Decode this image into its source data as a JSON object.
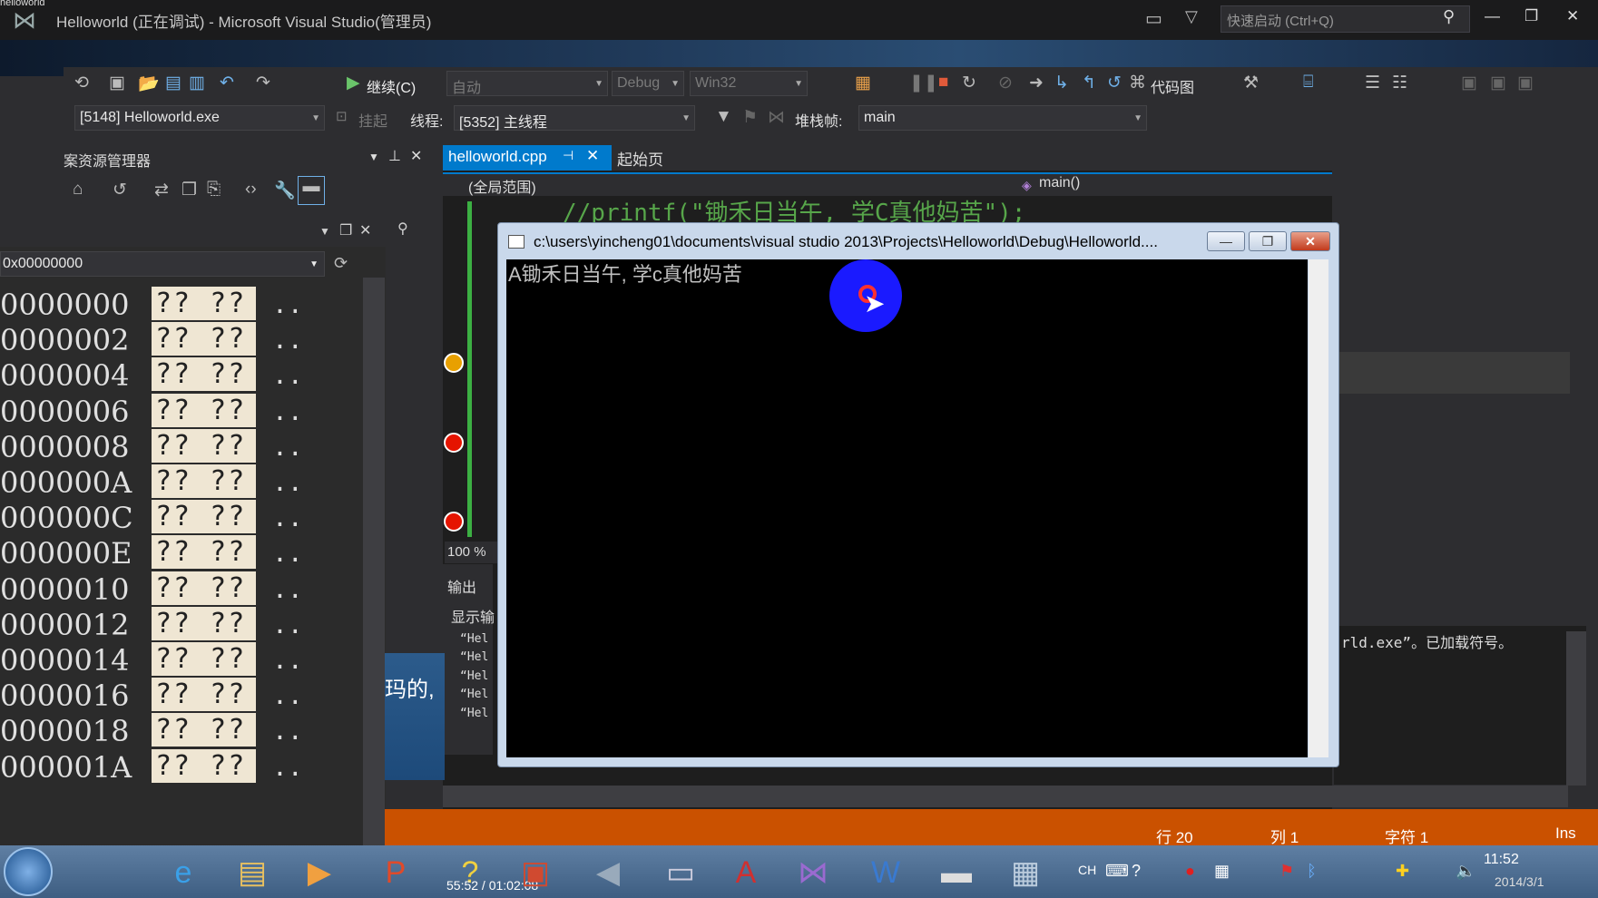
{
  "window": {
    "top_strip": "helloworld",
    "title": "Helloworld (正在调试) - Microsoft Visual Studio(管理员)",
    "quick_launch_placeholder": "快速启动 (Ctrl+Q)"
  },
  "toolbar": {
    "continue_label": "继续(C)",
    "launch_combo": "自动",
    "config_combo": "Debug",
    "platform_combo": "Win32",
    "codemap_label": "代码图",
    "process_combo": "[5148] Helloworld.exe",
    "suspend_label": "挂起",
    "thread_label": "线程:",
    "thread_combo": "[5352] 主线程",
    "stackframe_label": "堆栈帧:",
    "stackframe_combo": "main"
  },
  "solution_explorer": {
    "title": "案资源管理器"
  },
  "memory": {
    "address": "0x00000000",
    "rows": [
      {
        "addr": "0000000",
        "bytes": "?? ??",
        "chars": ".."
      },
      {
        "addr": "0000002",
        "bytes": "?? ??",
        "chars": ".."
      },
      {
        "addr": "0000004",
        "bytes": "?? ??",
        "chars": ".."
      },
      {
        "addr": "0000006",
        "bytes": "?? ??",
        "chars": ".."
      },
      {
        "addr": "0000008",
        "bytes": "?? ??",
        "chars": ".."
      },
      {
        "addr": "000000A",
        "bytes": "?? ??",
        "chars": ".."
      },
      {
        "addr": "000000C",
        "bytes": "?? ??",
        "chars": ".."
      },
      {
        "addr": "000000E",
        "bytes": "?? ??",
        "chars": ".."
      },
      {
        "addr": "0000010",
        "bytes": "?? ??",
        "chars": ".."
      },
      {
        "addr": "0000012",
        "bytes": "?? ??",
        "chars": ".."
      },
      {
        "addr": "0000014",
        "bytes": "?? ??",
        "chars": ".."
      },
      {
        "addr": "0000016",
        "bytes": "?? ??",
        "chars": ".."
      },
      {
        "addr": "0000018",
        "bytes": "?? ??",
        "chars": ".."
      },
      {
        "addr": "000001A",
        "bytes": "?? ??",
        "chars": ".."
      }
    ]
  },
  "editor": {
    "tab_active": "helloworld.cpp",
    "tab_start": "起始页",
    "scope": "(全局范围)",
    "function": "main()",
    "code_line": "//printf(\"锄禾日当午, 学C真他妈苦\");",
    "zoom": "100 %"
  },
  "output": {
    "title": "输出",
    "show_label": "显示输",
    "lines": [
      "“Hel",
      "“Hel",
      "“Hel",
      "“Hel",
      "“Hel"
    ],
    "right_text": "rld.exe”。已加载符号。"
  },
  "console": {
    "title": "c:\\users\\yincheng01\\documents\\visual studio 2013\\Projects\\Helloworld\\Debug\\Helloworld....",
    "text": "A锄禾日当午, 学c真他妈苦"
  },
  "status": {
    "line": "行 20",
    "col": "列 1",
    "char": "字符 1",
    "mode": "Ins"
  },
  "decor": {
    "blue_text": "玛的,"
  },
  "taskbar": {
    "media_time": "55:52 / 01:02:08",
    "lang": "CH",
    "clock": "11:52",
    "date": "2014/3/1"
  }
}
